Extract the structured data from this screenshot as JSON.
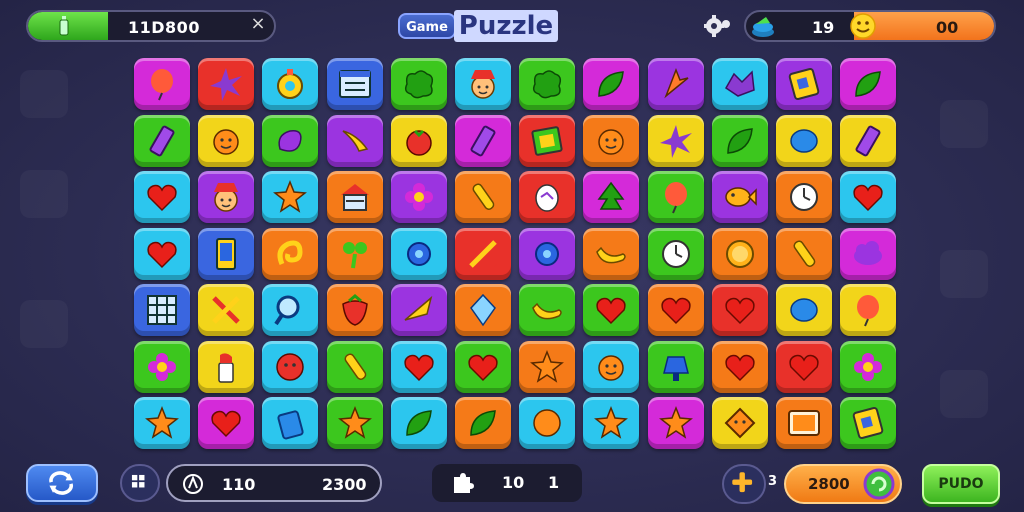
{
  "header": {
    "energy_value": "11D800",
    "close_symbol": "×",
    "title_small": "Game",
    "title_big": "Puzzle",
    "coins_value": "19",
    "coins_value_2": "00",
    "energy_icon": "bottle-icon",
    "gear_icon": "gear-icon",
    "coin_icon": "coin-pile-icon",
    "smile_icon": "smiley-icon"
  },
  "board": {
    "columns": 12,
    "rows": 7,
    "tiles": [
      [
        "magenta",
        "balloon"
      ],
      [
        "red",
        "star-burst"
      ],
      [
        "cyan",
        "ring"
      ],
      [
        "blue",
        "calendar"
      ],
      [
        "green",
        "blob"
      ],
      [
        "cyan",
        "face-hat"
      ],
      [
        "green",
        "blob"
      ],
      [
        "magenta",
        "leaf"
      ],
      [
        "purple",
        "arrow"
      ],
      [
        "cyan",
        "bird"
      ],
      [
        "purple",
        "card"
      ],
      [
        "magenta",
        "leaf"
      ],
      [
        "green",
        "pencil"
      ],
      [
        "yellow",
        "orange-face"
      ],
      [
        "green",
        "eggplant"
      ],
      [
        "purple",
        "comet"
      ],
      [
        "yellow",
        "tomato"
      ],
      [
        "magenta",
        "pencil"
      ],
      [
        "red",
        "frame"
      ],
      [
        "orange",
        "orange-face"
      ],
      [
        "yellow",
        "star-burst"
      ],
      [
        "green",
        "leaf"
      ],
      [
        "yellow",
        "bubble"
      ],
      [
        "yellow",
        "pencil"
      ],
      [
        "cyan",
        "heart"
      ],
      [
        "purple",
        "face-hat"
      ],
      [
        "cyan",
        "star"
      ],
      [
        "orange",
        "house"
      ],
      [
        "purple",
        "flower"
      ],
      [
        "orange",
        "carrot"
      ],
      [
        "red",
        "egg"
      ],
      [
        "magenta",
        "tree"
      ],
      [
        "green",
        "balloon"
      ],
      [
        "purple",
        "fish"
      ],
      [
        "orange",
        "clock"
      ],
      [
        "cyan",
        "heart"
      ],
      [
        "cyan",
        "heart"
      ],
      [
        "blue",
        "phone"
      ],
      [
        "orange",
        "swirl"
      ],
      [
        "orange",
        "plant"
      ],
      [
        "cyan",
        "gear"
      ],
      [
        "red",
        "crossed"
      ],
      [
        "purple",
        "gear"
      ],
      [
        "orange",
        "banana"
      ],
      [
        "green",
        "clock"
      ],
      [
        "orange",
        "orange-slice"
      ],
      [
        "orange",
        "carrot"
      ],
      [
        "magenta",
        "cloud"
      ],
      [
        "blue",
        "grid"
      ],
      [
        "yellow",
        "crossed"
      ],
      [
        "cyan",
        "magnifier"
      ],
      [
        "orange",
        "strawberry"
      ],
      [
        "purple",
        "plane"
      ],
      [
        "orange",
        "crystal"
      ],
      [
        "green",
        "banana"
      ],
      [
        "green",
        "heart"
      ],
      [
        "orange",
        "heart"
      ],
      [
        "red",
        "heart"
      ],
      [
        "yellow",
        "bubble"
      ],
      [
        "yellow",
        "balloon"
      ],
      [
        "green",
        "flower"
      ],
      [
        "yellow",
        "lipstick"
      ],
      [
        "cyan",
        "red-ball"
      ],
      [
        "green",
        "carrot"
      ],
      [
        "cyan",
        "heart"
      ],
      [
        "green",
        "heart"
      ],
      [
        "orange",
        "star"
      ],
      [
        "cyan",
        "orange-face"
      ],
      [
        "green",
        "lamp"
      ],
      [
        "orange",
        "heart"
      ],
      [
        "red",
        "heart"
      ],
      [
        "green",
        "flower"
      ],
      [
        "cyan",
        "star"
      ],
      [
        "magenta",
        "heart"
      ],
      [
        "cyan",
        "cup"
      ],
      [
        "green",
        "star"
      ],
      [
        "cyan",
        "leaf"
      ],
      [
        "orange",
        "leaf"
      ],
      [
        "cyan",
        "orange-ball"
      ],
      [
        "cyan",
        "star"
      ],
      [
        "magenta",
        "star"
      ],
      [
        "yellow",
        "diamond"
      ],
      [
        "orange",
        "tv"
      ],
      [
        "green",
        "card"
      ]
    ]
  },
  "footer": {
    "refresh_icon": "refresh-icon",
    "grid_icon": "grid-icon",
    "hint_icon": "hint-icon",
    "hint_value_1": "110",
    "hint_value_2": "2300",
    "moves_icon": "puzzle-icon",
    "moves_value_1": "10",
    "moves_value_2": "1",
    "add_icon": "plus-icon",
    "add_count": "3",
    "bonus_value": "2800",
    "bonus_icon": "orb-icon",
    "play_label": "PUDO"
  },
  "colors": {
    "green": "#3cc71e",
    "magenta": "#d42ad9",
    "red": "#e8312a",
    "cyan": "#2cc6ee",
    "blue": "#3a66e0",
    "yellow": "#f2d51a",
    "orange": "#f57a18",
    "purple": "#9b34e0"
  }
}
